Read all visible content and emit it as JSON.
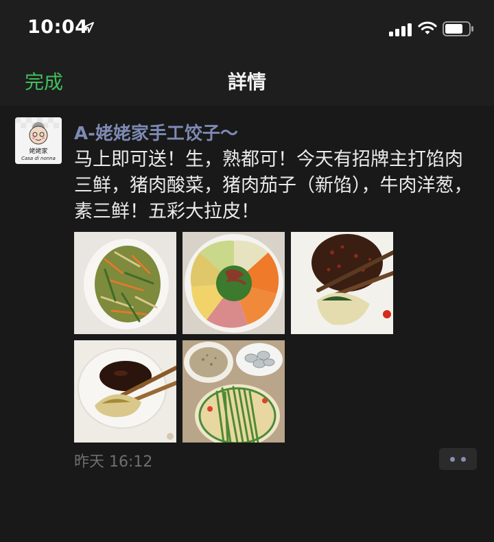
{
  "status_bar": {
    "time": "10:04",
    "icons": [
      "location-arrow-icon",
      "signal-icon",
      "wifi-icon",
      "battery-icon"
    ]
  },
  "nav": {
    "done_label": "完成",
    "title": "詳情"
  },
  "post": {
    "avatar": {
      "brand": "姥姥家",
      "subtitle": "Casa di nonna"
    },
    "author": "A-姥姥家手工饺子～",
    "text": "马上即可送！生，熟都可！今天有招牌主打馅肉三鲜，猪肉酸菜，猪肉茄子（新馅），牛肉洋葱，素三鲜！五彩大拉皮！",
    "photos": [
      {
        "name": "photo-shredded-vegetable-salad"
      },
      {
        "name": "photo-colorful-cold-noodle-platter"
      },
      {
        "name": "photo-dumpling-with-chili-sauce"
      },
      {
        "name": "photo-dumpling-in-soy-sauce"
      },
      {
        "name": "photo-dumpling-ingredients"
      }
    ],
    "timestamp": "昨天 16:12",
    "more_icon": "more-dots-icon"
  },
  "colors": {
    "accent_green": "#3fbf5c",
    "author_blue": "#7d8ab3",
    "background": "#191919"
  }
}
